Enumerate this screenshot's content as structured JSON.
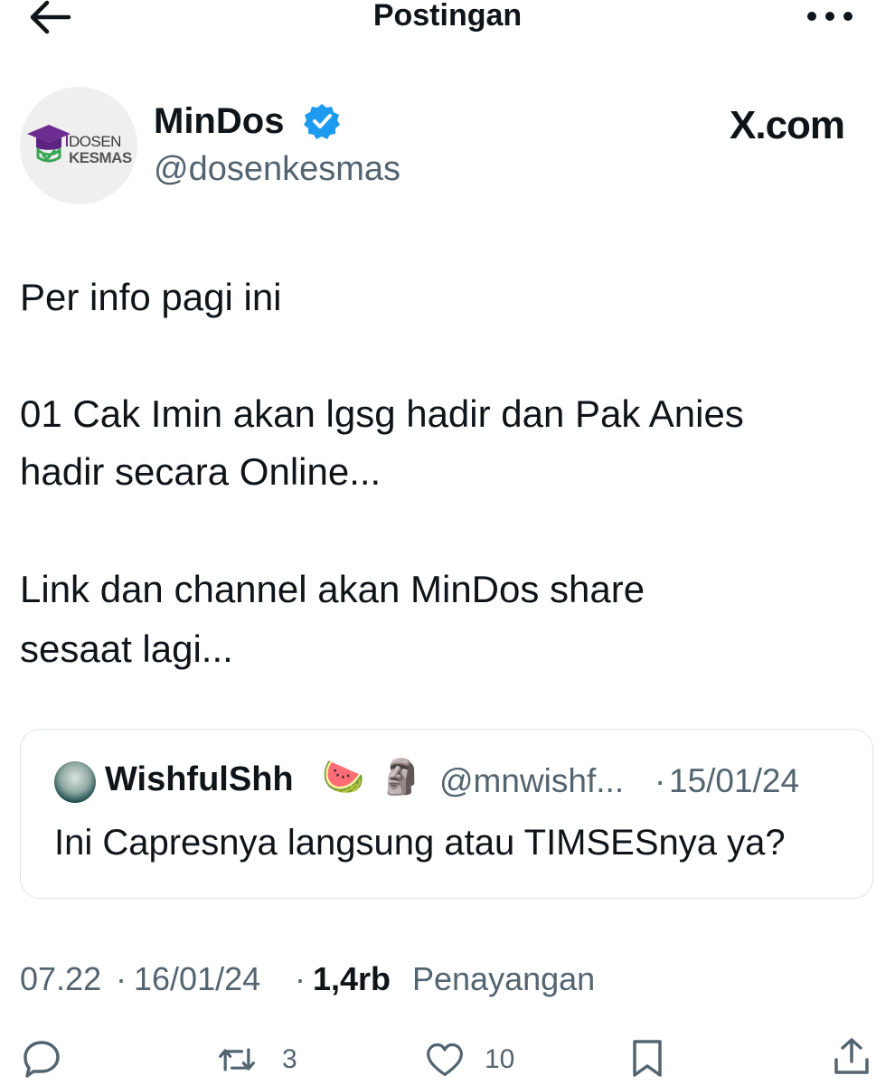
{
  "header": {
    "title": "Postingan"
  },
  "author": {
    "name": "MinDos",
    "handle": "@dosenkesmas",
    "avatar_text_line1": "DOSEN",
    "avatar_text_line2": "KESMAS",
    "watermark": "X.com"
  },
  "tweet": {
    "lines": [
      "Per info pagi ini",
      "01 Cak Imin akan lgsg hadir dan Pak Anies",
      "hadir secara Online...",
      "Link dan channel akan MinDos share",
      "sesaat lagi..."
    ]
  },
  "quote": {
    "name": "WishfulShh",
    "emoji1": "🍉",
    "emoji2": "🗿",
    "handle": "@mnwishf...",
    "separator": "·",
    "date": "15/01/24",
    "text": "Ini Capresnya langsung atau TIMSESnya ya?"
  },
  "meta": {
    "time": "07.22",
    "sep1": "·",
    "date": "16/01/24",
    "sep2": "·",
    "views_count": "1,4rb",
    "views_label": "Penayangan"
  },
  "actions": {
    "reply_icon": "reply-icon",
    "repost_count": "3",
    "like_count": "10",
    "bookmark_icon": "bookmark-icon",
    "share_icon": "share-icon"
  },
  "colors": {
    "text": "#0f1419",
    "secondary": "#536471",
    "verified": "#1d9bf0",
    "border": "#dfe3e6"
  }
}
